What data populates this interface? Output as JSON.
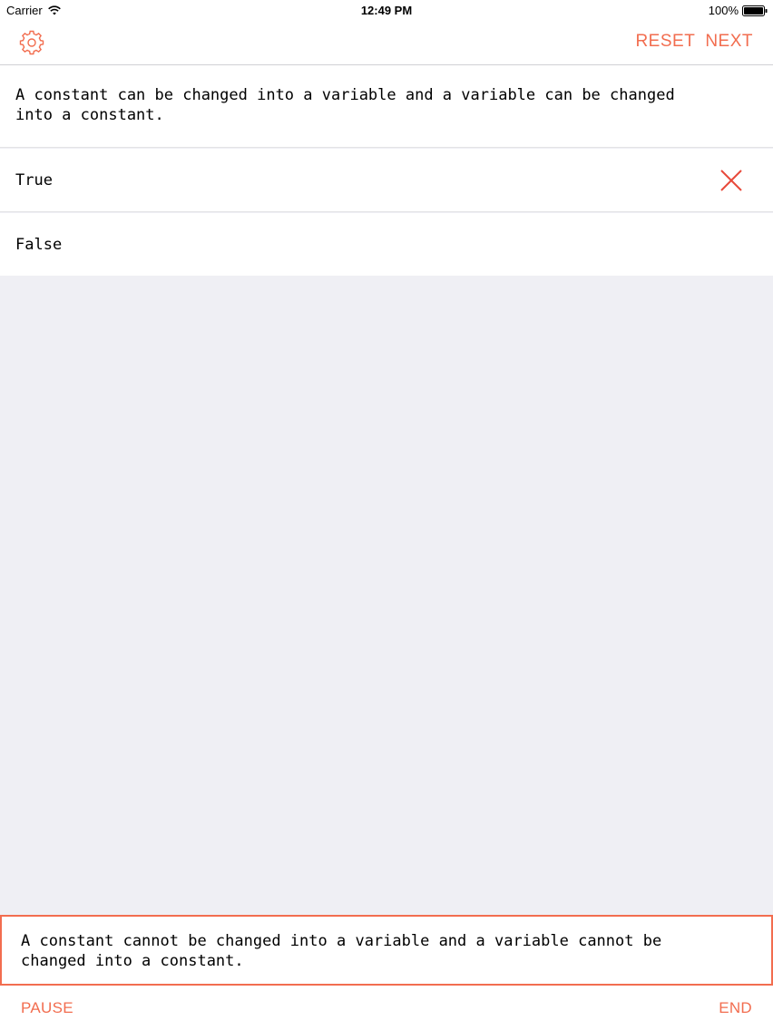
{
  "status_bar": {
    "carrier": "Carrier",
    "time": "12:49 PM",
    "battery": "100%"
  },
  "nav": {
    "settings_icon": "gear-icon",
    "reset_label": "RESET",
    "next_label": "NEXT"
  },
  "question": {
    "text": "A constant can be changed into a variable and a variable can be changed\ninto a constant."
  },
  "options": [
    {
      "label": "True",
      "marked": "wrong"
    },
    {
      "label": "False"
    }
  ],
  "answer": {
    "text": "A constant cannot be changed into a variable and a variable cannot be\nchanged into a constant."
  },
  "bottom": {
    "pause_label": "PAUSE",
    "end_label": "END"
  },
  "colors": {
    "accent": "#f26d4f",
    "wrong": "#e8493a",
    "background": "#efeff4"
  }
}
